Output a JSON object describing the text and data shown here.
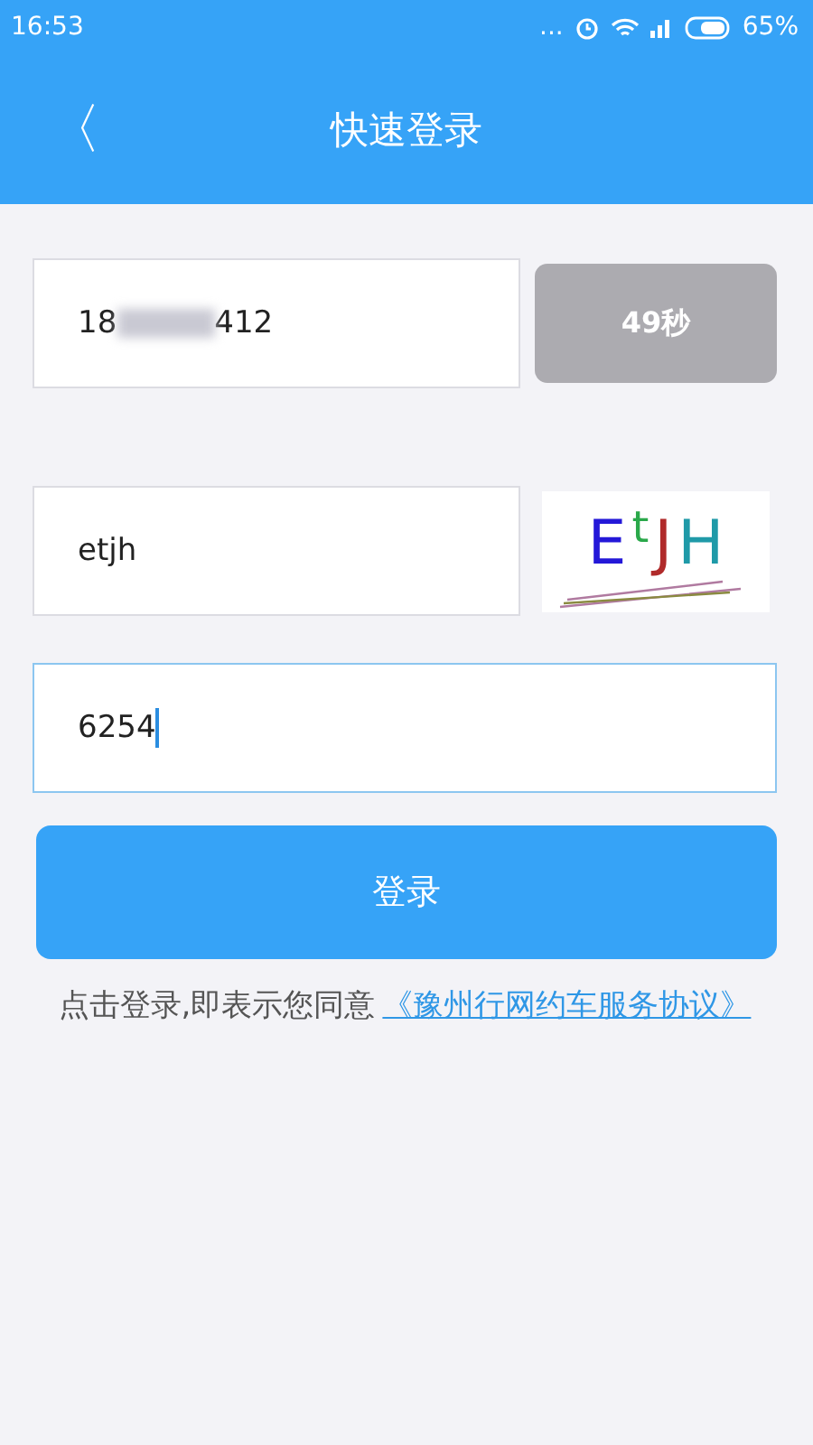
{
  "status_bar": {
    "time": "16:53",
    "more": "...",
    "battery": "65%"
  },
  "header": {
    "title": "快速登录",
    "back": "〈"
  },
  "phone": {
    "value_start": "18",
    "value_end": "412",
    "redacted": true
  },
  "code_button": {
    "label": "49秒",
    "disabled": true
  },
  "captcha_field": {
    "value": "etjh"
  },
  "captcha": {
    "letters": [
      {
        "char": "E",
        "color": "#2418d8"
      },
      {
        "char": "t",
        "color": "#2aa84a"
      },
      {
        "char": "J",
        "color": "#b02a2a"
      },
      {
        "char": "H",
        "color": "#1f9aa8"
      }
    ]
  },
  "sms_field": {
    "value": "6254",
    "focused": true
  },
  "login_button": {
    "label": "登录"
  },
  "agreement": {
    "text": "点击登录,即表示您同意",
    "link": "《豫州行网约车服务协议》"
  }
}
